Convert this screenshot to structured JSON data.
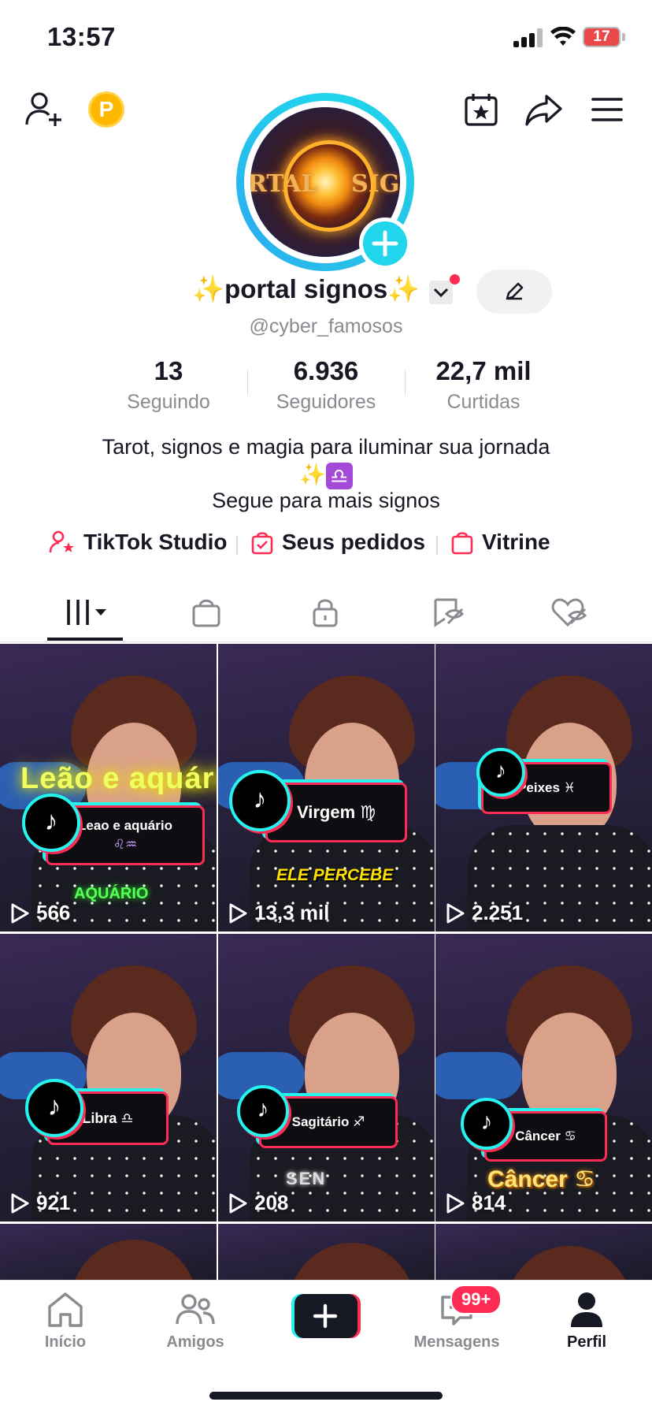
{
  "status_bar": {
    "time": "13:57",
    "battery": "17"
  },
  "profile": {
    "avatar_text_left": "RTAL",
    "avatar_text_right": "SIGN",
    "display_name": "✨portal signos✨",
    "username": "@cyber_famosos",
    "stats": [
      {
        "value": "13",
        "label": "Seguindo"
      },
      {
        "value": "6.936",
        "label": "Seguidores"
      },
      {
        "value": "22,7 mil",
        "label": "Curtidas"
      }
    ],
    "bio_line1": "Tarot, signos e magia para iluminar sua jornada",
    "bio_line2_sparkle": "✨",
    "bio_line2_libra": "♎",
    "bio_line3": "Segue para mais signos",
    "links": [
      {
        "label": "TikTok Studio",
        "icon": "person-star-icon"
      },
      {
        "label": "Seus pedidos",
        "icon": "order-bag-icon"
      },
      {
        "label": "Vitrine",
        "icon": "shop-bag-icon"
      }
    ]
  },
  "tabs": [
    "videos-grid-icon",
    "shop-bag-icon",
    "lock-icon",
    "reposts-icon",
    "liked-icon"
  ],
  "videos": [
    {
      "label": "Leao e aquário",
      "signs": "♌♒",
      "views": "566",
      "overlay_top": "Leão e aquário",
      "overlay_bottom": "AQUÁRIO"
    },
    {
      "label": "Virgem ♍",
      "views": "13,3 mil",
      "overlay_bottom": "ELE PERCEBE"
    },
    {
      "label": "Peixes ♓",
      "views": "2.251"
    },
    {
      "label": "Libra ♎",
      "views": "921"
    },
    {
      "label": "Sagitário ♐",
      "views": "208",
      "overlay_bottom": "SEN"
    },
    {
      "label": "Câncer ♋",
      "views": "814",
      "overlay_bottom": "Câncer ♋"
    }
  ],
  "bottom_nav": {
    "home": "Início",
    "friends": "Amigos",
    "messages": "Mensagens",
    "messages_badge": "99+",
    "profile": "Perfil"
  },
  "colors": {
    "accent_red": "#fe2c55",
    "accent_cyan": "#20d5ec",
    "text": "#161823",
    "muted": "#8a8b91"
  }
}
